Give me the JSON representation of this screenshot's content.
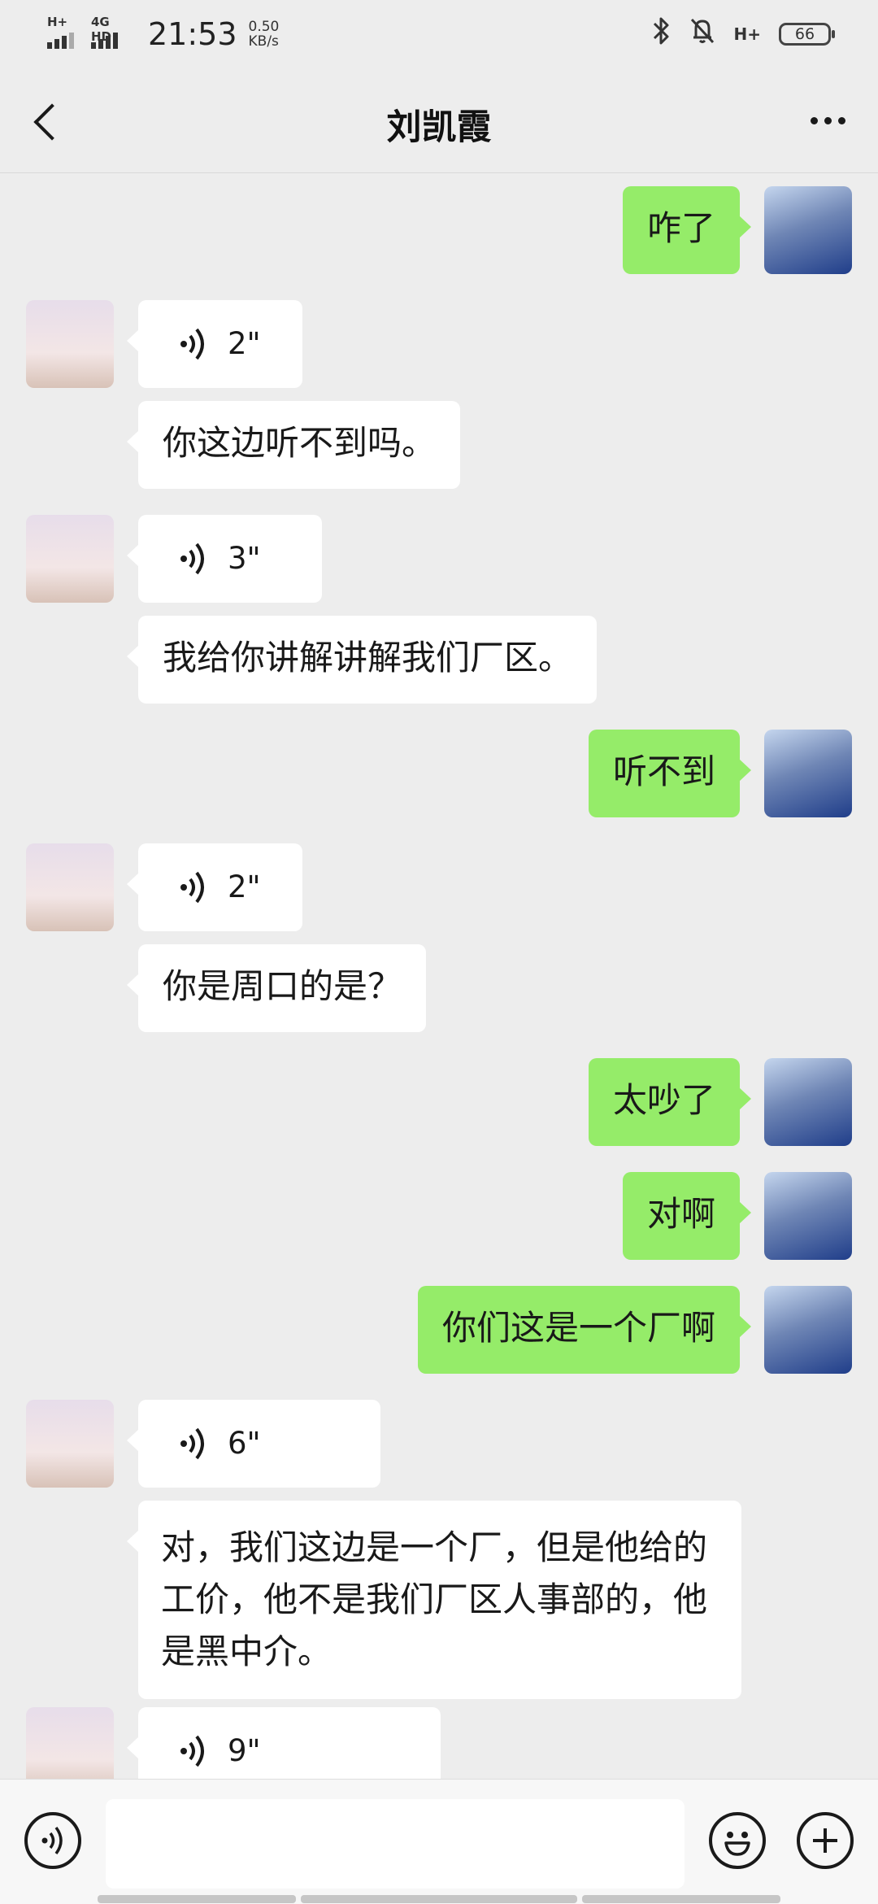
{
  "status_bar": {
    "net1": "H+",
    "net2": "4G HD",
    "time": "21:53",
    "speed_value": "0.50",
    "speed_unit": "KB/s",
    "bt_icon": "bluetooth-icon",
    "mute_icon": "bell-off-icon",
    "net3": "H+",
    "battery": "66"
  },
  "header": {
    "title": "刘凯霞"
  },
  "messages": [
    {
      "side": "out",
      "type": "text",
      "text": "咋了"
    },
    {
      "side": "in",
      "type": "voice",
      "duration": "2\""
    },
    {
      "side": "in",
      "type": "text",
      "text": "你这边听不到吗。"
    },
    {
      "side": "in",
      "type": "voice",
      "duration": "3\""
    },
    {
      "side": "in",
      "type": "text",
      "text": "我给你讲解讲解我们厂区。"
    },
    {
      "side": "out",
      "type": "text",
      "text": "听不到"
    },
    {
      "side": "in",
      "type": "voice",
      "duration": "2\""
    },
    {
      "side": "in",
      "type": "text",
      "text": "你是周口的是？"
    },
    {
      "side": "out",
      "type": "text",
      "text": "太吵了"
    },
    {
      "side": "out",
      "type": "text",
      "text": "对啊"
    },
    {
      "side": "out",
      "type": "text",
      "text": "你们这是一个厂啊"
    },
    {
      "side": "in",
      "type": "voice",
      "duration": "6\""
    },
    {
      "side": "in",
      "type": "text",
      "text": "对，我们这边是一个厂，但是他给的工价，他不是我们厂区人事部的，他是黑中介。"
    },
    {
      "side": "in",
      "type": "voice",
      "duration": "9\""
    }
  ],
  "input_bar": {
    "voice_icon": "voice-input-icon",
    "text_value": "",
    "emoji_icon": "emoji-icon",
    "plus_icon": "plus-icon"
  }
}
